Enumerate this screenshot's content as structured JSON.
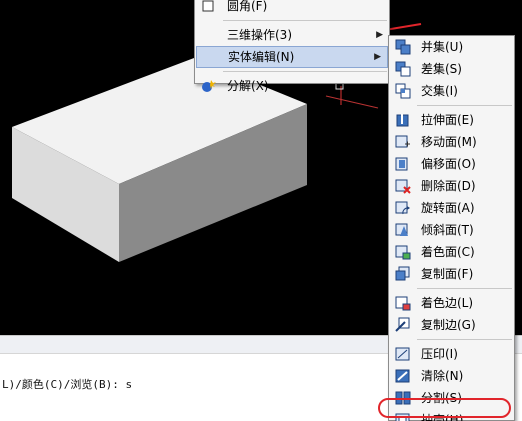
{
  "main_menu": {
    "items": [
      {
        "label": "圆角(F)",
        "has_submenu": false,
        "icon": "fillet-icon"
      },
      {
        "label": "三维操作(3)",
        "has_submenu": true,
        "icon": null
      },
      {
        "label": "实体编辑(N)",
        "has_submenu": true,
        "icon": null,
        "highlighted": true
      },
      {
        "label": "分解(X)",
        "has_submenu": false,
        "icon": "explode-icon"
      }
    ]
  },
  "submenu": {
    "groups": [
      [
        {
          "label": "并集(U)",
          "icon": "union-icon"
        },
        {
          "label": "差集(S)",
          "icon": "subtract-icon"
        },
        {
          "label": "交集(I)",
          "icon": "intersect-icon"
        }
      ],
      [
        {
          "label": "拉伸面(E)",
          "icon": "extrude-face-icon"
        },
        {
          "label": "移动面(M)",
          "icon": "move-face-icon"
        },
        {
          "label": "偏移面(O)",
          "icon": "offset-face-icon"
        },
        {
          "label": "删除面(D)",
          "icon": "delete-face-icon"
        },
        {
          "label": "旋转面(A)",
          "icon": "rotate-face-icon"
        },
        {
          "label": "倾斜面(T)",
          "icon": "taper-face-icon"
        },
        {
          "label": "着色面(C)",
          "icon": "color-face-icon"
        },
        {
          "label": "复制面(F)",
          "icon": "copy-face-icon"
        }
      ],
      [
        {
          "label": "着色边(L)",
          "icon": "color-edge-icon"
        },
        {
          "label": "复制边(G)",
          "icon": "copy-edge-icon"
        }
      ],
      [
        {
          "label": "压印(I)",
          "icon": "imprint-icon"
        },
        {
          "label": "清除(N)",
          "icon": "clean-icon"
        },
        {
          "label": "分割(S)",
          "icon": "separate-icon"
        },
        {
          "label": "抽壳(H)",
          "icon": "shell-icon",
          "circled": true
        }
      ]
    ]
  },
  "command_line": {
    "text": "L)/颜色(C)/浏览(B): s"
  },
  "colors": {
    "annotation_red": "#e1252b",
    "menu_highlight": "#c9d8ef",
    "viewport_bg": "#000000"
  }
}
